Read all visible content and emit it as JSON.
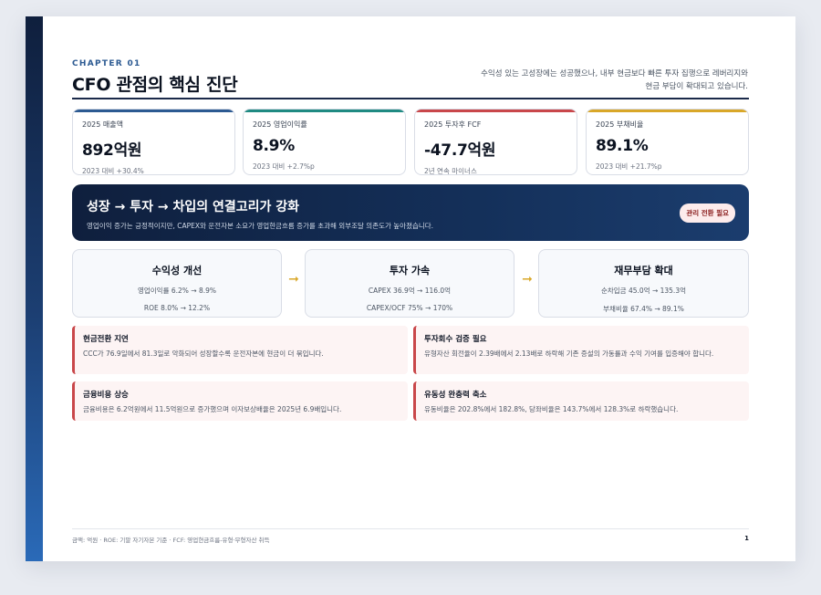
{
  "header": {
    "chapter": "CHAPTER 01",
    "title": "CFO 관점의 핵심 진단",
    "summary": "수익성 있는 고성장에는 성공했으나, 내부 현금보다 빠른 투자 집행으로 레버리지와 현금 부담이 확대되고 있습니다."
  },
  "kpis": [
    {
      "label": "2025 매출액",
      "value": "892억원",
      "note": "2023 대비 +30.4%",
      "color": "#2c5a92"
    },
    {
      "label": "2025 영업이익률",
      "value": "8.9%",
      "note": "2023 대비 +2.7%p",
      "color": "#1f8a82"
    },
    {
      "label": "2025 투자후 FCF",
      "value": "-47.7억원",
      "note": "2년 연속 마이너스",
      "color": "#c9474a"
    },
    {
      "label": "2025 부채비율",
      "value": "89.1%",
      "note": "2023 대비 +21.7%p",
      "color": "#d9a728"
    }
  ],
  "banner": {
    "title": "성장 → 투자 → 차입의 연결고리가 강화",
    "subtitle": "영업이익 증가는 긍정적이지만, CAPEX와 운전자본 소요가 영업현금흐름 증가를 초과해 외부조달 의존도가 높아졌습니다.",
    "badge": "관리 전환 필요"
  },
  "flow": [
    {
      "title": "수익성 개선",
      "line1": "영업이익률 6.2% → 8.9%",
      "line2": "ROE 8.0% → 12.2%"
    },
    {
      "title": "투자 가속",
      "line1": "CAPEX 36.9억 → 116.0억",
      "line2": "CAPEX/OCF 75% → 170%"
    },
    {
      "title": "재무부담 확대",
      "line1": "순차입금 45.0억 → 135.3억",
      "line2": "부채비율 67.4% → 89.1%"
    }
  ],
  "flow_arrow": "➞",
  "notes": [
    {
      "title": "현금전환 지연",
      "text": "CCC가 76.9일에서 81.3일로 악화되어 성장할수록 운전자본에 현금이 더 묶입니다."
    },
    {
      "title": "투자회수 검증 필요",
      "text": "유형자산 회전율이 2.39배에서 2.13배로 하락해 기존 증설의 가동률과 수익 기여를 입증해야 합니다."
    },
    {
      "title": "금융비용 상승",
      "text": "금융비용은 6.2억원에서 11.5억원으로 증가했으며 이자보상배율은 2025년 6.9배입니다."
    },
    {
      "title": "유동성 완충력 축소",
      "text": "유동비율은 202.8%에서 182.8%, 당좌비율은 143.7%에서 128.3%로 하락했습니다."
    }
  ],
  "footer": {
    "note": "금액: 억원 · ROE: 기말 자기자본 기준 · FCF: 영업현금흐름-유형·무형자산 취득",
    "page": "1"
  }
}
